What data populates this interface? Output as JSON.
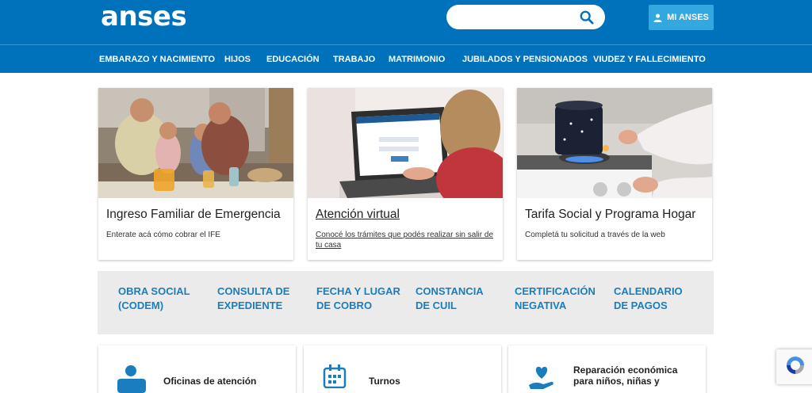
{
  "header": {
    "logo": "anses",
    "search": {
      "placeholder": "",
      "icon": "search-icon"
    },
    "account_button": "MI ANSES"
  },
  "nav": {
    "items": [
      "EMBARAZO Y NACIMIENTO",
      "HIJOS",
      "EDUCACIÓN",
      "TRABAJO",
      "MATRIMONIO",
      "JUBILADOS Y PENSIONADOS",
      "VIUDEZ Y FALLECIMIENTO"
    ]
  },
  "cards": [
    {
      "title": "Ingreso Familiar de Emergencia",
      "subtitle": "Enterate acá cómo cobrar el IFE"
    },
    {
      "title": "Atención virtual",
      "subtitle": "Conocé los trámites que podés realizar sin salir de tu casa"
    },
    {
      "title": "Tarifa Social y Programa Hogar",
      "subtitle": "Completá tu solicitud a través de la web"
    }
  ],
  "quick_links": [
    {
      "line1": "OBRA SOCIAL",
      "line2": "(CODEM)"
    },
    {
      "line1": "CONSULTA DE",
      "line2": "EXPEDIENTE"
    },
    {
      "line1": "FECHA Y LUGAR",
      "line2": "DE COBRO"
    },
    {
      "line1": "CONSTANCIA",
      "line2": "DE CUIL"
    },
    {
      "line1": "CERTIFICACIÓN",
      "line2": "NEGATIVA"
    },
    {
      "line1": "CALENDARIO",
      "line2": "DE PAGOS"
    }
  ],
  "bottom_cards": [
    {
      "label": "Oficinas de atención",
      "icon": "office-person-icon"
    },
    {
      "label": "Turnos",
      "icon": "calendar-icon"
    },
    {
      "label": "Reparación económica para niños, niñas y",
      "icon": "heart-hands-icon"
    }
  ],
  "colors": {
    "brand_blue": "#0072bb",
    "button_blue": "#33a7e0",
    "link_blue": "#1a7dbe",
    "panel_gray": "#ebebeb"
  }
}
